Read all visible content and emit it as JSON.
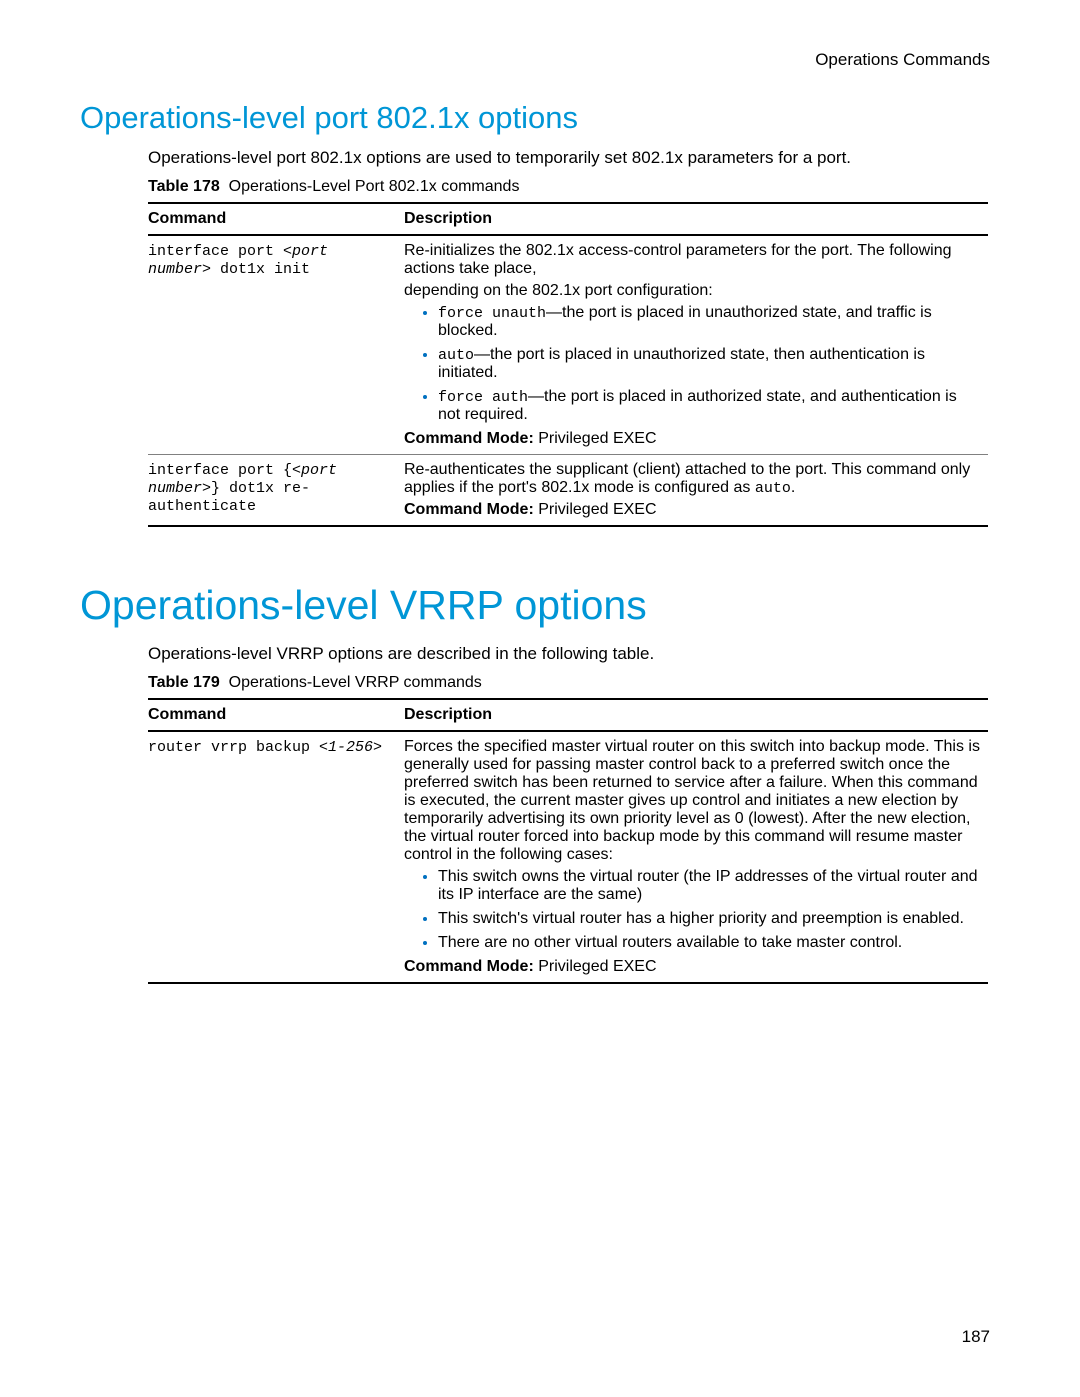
{
  "header": {
    "running": "Operations Commands"
  },
  "page_number": "187",
  "section1": {
    "title": "Operations-level port 802.1x options",
    "intro": "Operations-level port 802.1x options are used to temporarily set 802.1x parameters for a port.",
    "caption_label": "Table 178",
    "caption_text": "Operations-Level Port 802.1x commands",
    "headers": {
      "cmd": "Command",
      "desc": "Description"
    },
    "rows": [
      {
        "cmd_pre": "interface port <",
        "cmd_param": "port number",
        "cmd_post": "> dot1x init",
        "desc1": "Re-initializes the 802.1x access-control parameters for the port. The following actions take place,",
        "desc2": "depending on the 802.1x port configuration:",
        "b1_code": "force unauth",
        "b1_text": "—the port is placed in unauthorized state, and traffic is blocked.",
        "b2_code": "auto",
        "b2_text": "—the port is placed in unauthorized state, then authentication is initiated.",
        "b3_code": "force auth",
        "b3_text": "—the port is placed in authorized state, and authentication is not required.",
        "mode_label": "Command Mode:",
        "mode_value": "Privileged EXEC"
      },
      {
        "cmd_pre": "interface port {<",
        "cmd_param": "port number",
        "cmd_post": ">} dot1x re-authenticate",
        "desc1_a": "Re-authenticates the supplicant (client) attached to the port. This command only applies if the port's 802.1x mode is configured as ",
        "desc1_code": "auto",
        "desc1_b": ".",
        "mode_label": "Command Mode:",
        "mode_value": "Privileged EXEC"
      }
    ]
  },
  "section2": {
    "title": "Operations-level VRRP options",
    "intro": "Operations-level VRRP options are described in the following table.",
    "caption_label": "Table 179",
    "caption_text": "Operations-Level VRRP commands",
    "headers": {
      "cmd": "Command",
      "desc": "Description"
    },
    "row": {
      "cmd_pre": "router vrrp backup <",
      "cmd_param": "1-256",
      "cmd_post": ">",
      "desc1": "Forces the specified master virtual router on this switch into backup mode. This is generally used for passing master control back to a preferred switch once the preferred switch has been returned to service after a failure. When this command is executed, the current master gives up control and initiates a new election by temporarily advertising its own priority level as 0 (lowest). After the new election, the virtual router forced into backup mode by this command will resume master control in the following cases:",
      "b1": "This switch owns the virtual router (the IP addresses of the virtual router and its IP interface are the same)",
      "b2": "This switch's virtual router has a higher priority and preemption is enabled.",
      "b3": "There are no other virtual routers available to take master control.",
      "mode_label": "Command Mode:",
      "mode_value": "Privileged EXEC"
    }
  }
}
